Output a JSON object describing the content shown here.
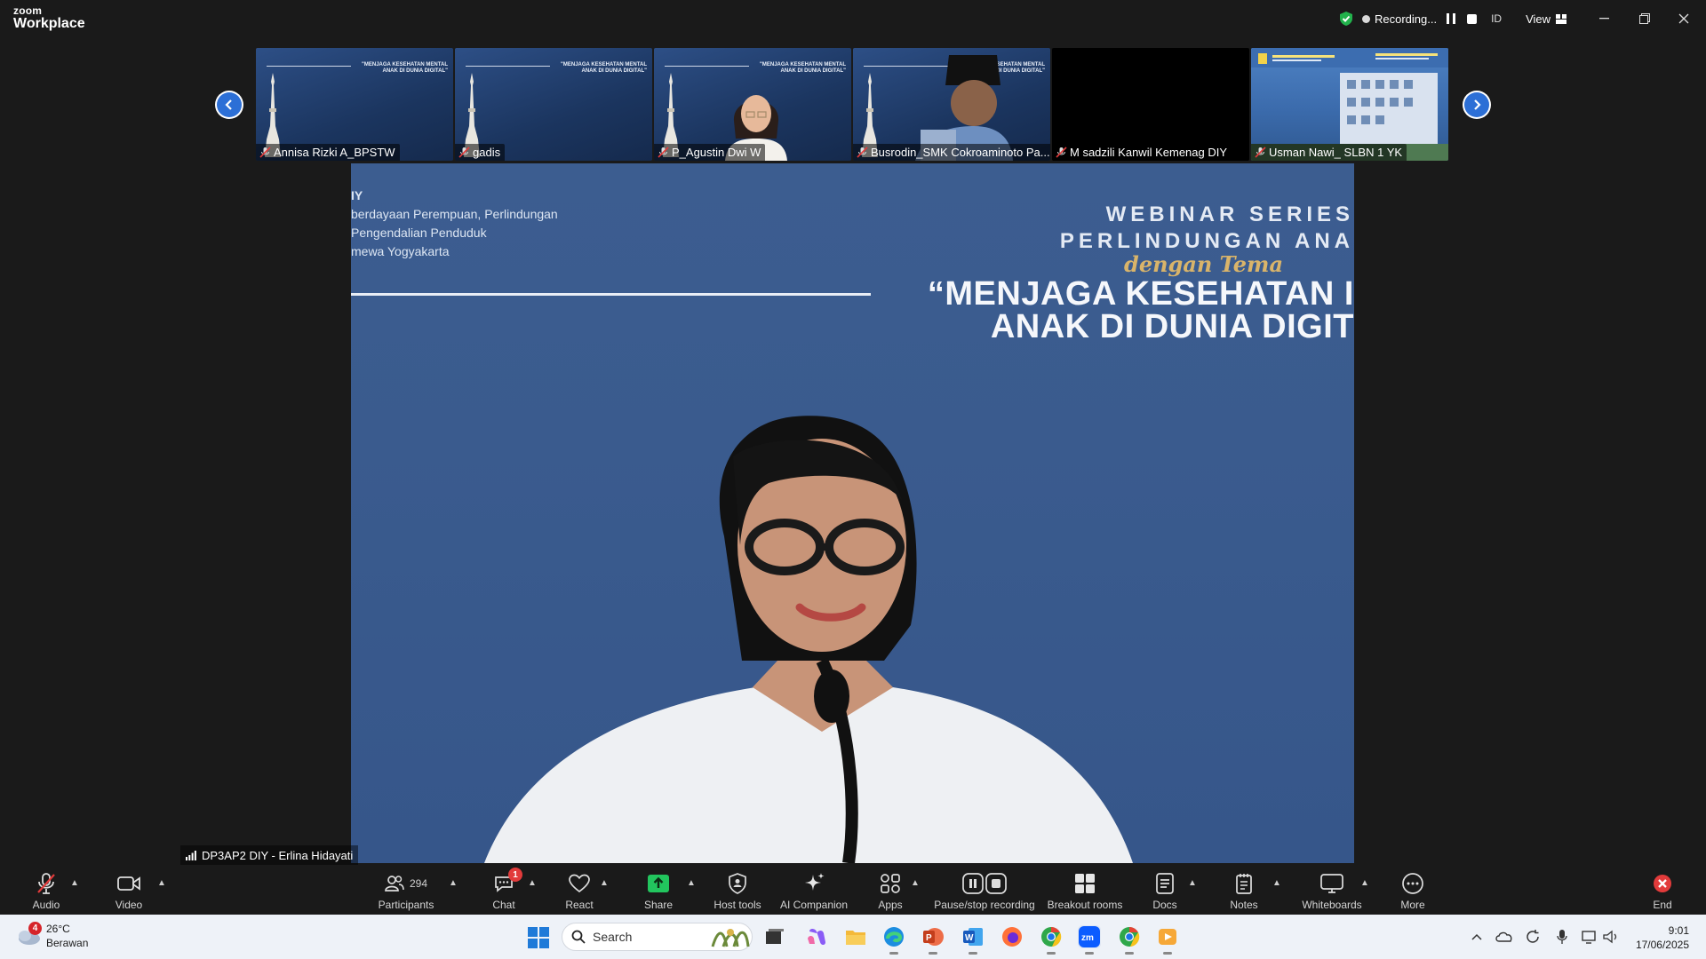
{
  "app": {
    "brand_top": "zoom",
    "brand_bottom": "Workplace"
  },
  "titlebar": {
    "recording_label": "Recording...",
    "id_label": "ID",
    "view_label": "View"
  },
  "gallery": {
    "tiles": [
      {
        "name": "Annisa Rizki A_BPSTW",
        "style": "slide",
        "muted": true
      },
      {
        "name": "gadis",
        "style": "slide",
        "muted": true
      },
      {
        "name": "P_Agustin Dwi W",
        "style": "person",
        "muted": true
      },
      {
        "name": "Busrodin_SMK Cokroaminoto Pa...",
        "style": "person-cap",
        "muted": true
      },
      {
        "name": "M sadzili Kanwil Kemenag DIY",
        "style": "black",
        "muted": true
      },
      {
        "name": "Usman Nawi_ SLBN 1 YK",
        "style": "school",
        "muted": true
      }
    ],
    "slide_caption": "\"MENJAGA KESEHATAN MENTAL ANAK DI DUNIA DIGITAL\""
  },
  "stage": {
    "org_lines": [
      "IY",
      "berdayaan Perempuan, Perlindungan",
      "Pengendalian Penduduk",
      "mewa Yogyakarta"
    ],
    "webinar_line1": "WEBINAR SERIES",
    "webinar_line2": "PERLINDUNGAN ANA",
    "theme_line": "dengan Tema",
    "headline1": "“MENJAGA KESEHATAN I",
    "headline2": "ANAK DI DUNIA DIGIT",
    "speaker_name": "DP3AP2 DIY - Erlina Hidayati"
  },
  "toolbar": {
    "audio": "Audio",
    "video": "Video",
    "participants": "Participants",
    "participants_count": "294",
    "chat": "Chat",
    "chat_badge": "1",
    "react": "React",
    "share": "Share",
    "host_tools": "Host tools",
    "ai_companion": "AI Companion",
    "apps": "Apps",
    "pause_recording": "Pause/stop recording",
    "breakout_rooms": "Breakout rooms",
    "docs": "Docs",
    "notes": "Notes",
    "whiteboards": "Whiteboards",
    "more": "More",
    "end": "End"
  },
  "taskbar": {
    "weather_temp": "26°C",
    "weather_desc": "Berawan",
    "weather_badge": "4",
    "search_placeholder": "Search",
    "time": "9:01",
    "date": "17/06/2025"
  },
  "colors": {
    "accent_blue": "#2c6fd6",
    "share_green": "#22c55e",
    "end_red": "#e23b3b"
  }
}
